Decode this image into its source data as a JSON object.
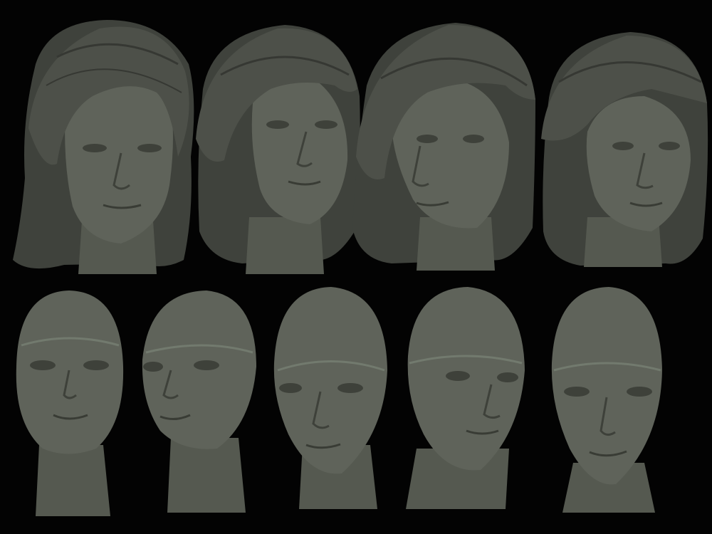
{
  "clay_colors": {
    "base": "#5a5e56",
    "light": "#737a70",
    "shadow": "#3c3f39",
    "deep": "#2a2c28",
    "background": "#030303"
  },
  "rows": [
    {
      "id": "with-hair",
      "heads": [
        {
          "id": "hair-1",
          "turn": 0.0,
          "hair": "full-side-part"
        },
        {
          "id": "hair-2",
          "turn": 0.25,
          "hair": "full-side-part"
        },
        {
          "id": "hair-3",
          "turn": 0.3,
          "hair": "full-side-part"
        },
        {
          "id": "hair-4",
          "turn": 0.15,
          "hair": "full-side-part"
        }
      ]
    },
    {
      "id": "bald",
      "heads": [
        {
          "id": "bald-1",
          "turn": 0.0,
          "hair": "none"
        },
        {
          "id": "bald-2",
          "turn": 0.3,
          "hair": "none"
        },
        {
          "id": "bald-3",
          "turn": 0.05,
          "hair": "none"
        },
        {
          "id": "bald-4",
          "turn": 0.2,
          "hair": "none"
        },
        {
          "id": "bald-5",
          "turn": 0.0,
          "hair": "none"
        }
      ]
    }
  ]
}
